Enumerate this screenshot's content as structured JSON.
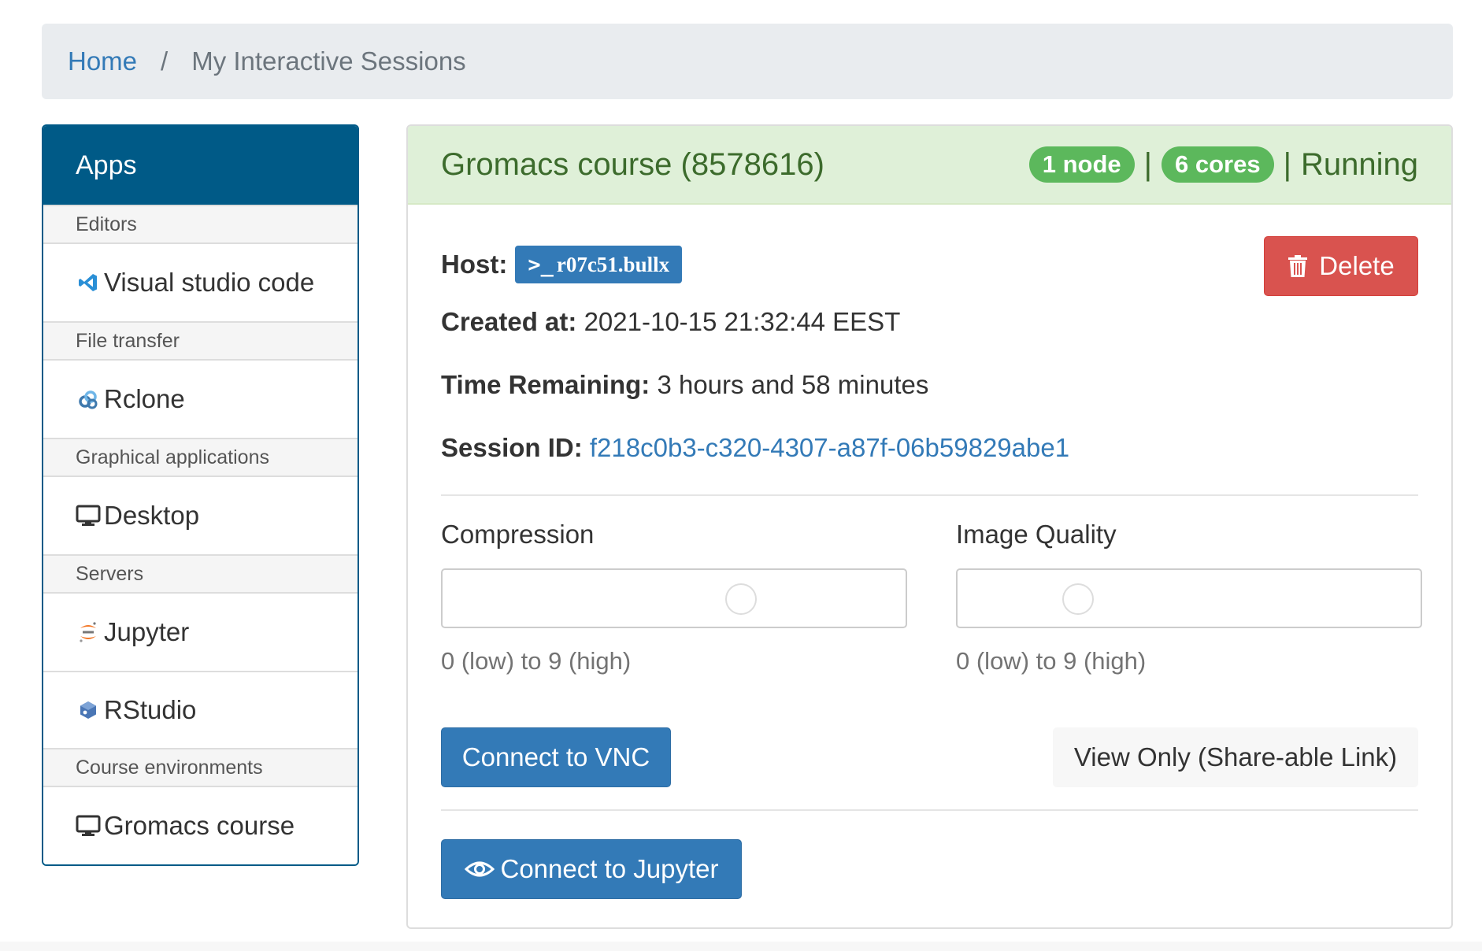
{
  "breadcrumb": {
    "home": "Home",
    "separator": "/",
    "current": "My Interactive Sessions"
  },
  "sidebar": {
    "header": "Apps",
    "sections": [
      {
        "category": "Editors",
        "items": [
          {
            "label": "Visual studio code",
            "icon": "vscode-icon"
          }
        ]
      },
      {
        "category": "File transfer",
        "items": [
          {
            "label": "Rclone",
            "icon": "rclone-icon"
          }
        ]
      },
      {
        "category": "Graphical applications",
        "items": [
          {
            "label": "Desktop",
            "icon": "monitor-icon"
          }
        ]
      },
      {
        "category": "Servers",
        "items": [
          {
            "label": "Jupyter",
            "icon": "jupyter-icon"
          },
          {
            "label": "RStudio",
            "icon": "rstudio-icon"
          }
        ]
      },
      {
        "category": "Course environments",
        "items": [
          {
            "label": "Gromacs course",
            "icon": "monitor-icon"
          }
        ]
      }
    ]
  },
  "session": {
    "title": "Gromacs course (8578616)",
    "nodes_badge": "1 node",
    "cores_badge": "6 cores",
    "pipe": "|",
    "status": "Running",
    "host_label": "Host:",
    "host_prompt": ">_",
    "host_value": "r07c51.bullx",
    "created_label": "Created at:",
    "created_value": "2021-10-15 21:32:44 EEST",
    "remaining_label": "Time Remaining:",
    "remaining_value": "3 hours and 58 minutes",
    "session_id_label": "Session ID:",
    "session_id_value": "f218c0b3-c320-4307-a87f-06b59829abe1",
    "delete_label": "Delete",
    "compression_label": "Compression",
    "compression_level": 6,
    "compression_help": "0 (low) to 9 (high)",
    "quality_label": "Image Quality",
    "quality_level": 2,
    "quality_help": "0 (low) to 9 (high)",
    "connect_vnc_label": "Connect to VNC",
    "share_label": "View Only (Share-able Link)",
    "connect_jupyter_label": "Connect to Jupyter"
  },
  "colors": {
    "primary": "#337ab7",
    "sidebar_header": "#005a87",
    "success_badge": "#5cb85c",
    "success_bg": "#dff0d8",
    "danger": "#d9534f"
  }
}
